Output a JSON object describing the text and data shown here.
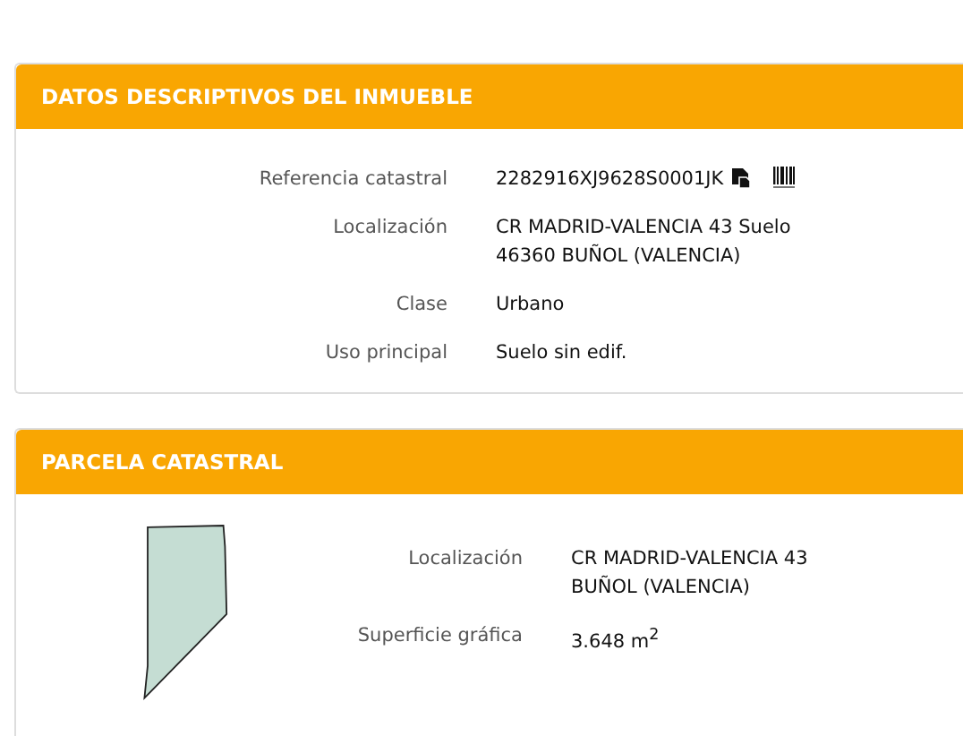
{
  "panels": [
    {
      "title": "DATOS DESCRIPTIVOS DEL INMUEBLE",
      "kind": "details",
      "rows": [
        {
          "label": "Referencia catastral",
          "lines": [
            "2282916XJ9628S0001JK"
          ],
          "icons": true
        },
        {
          "label": "Localización",
          "lines": [
            "CR MADRID-VALENCIA 43 Suelo",
            "46360 BUÑOL (VALENCIA)"
          ]
        },
        {
          "label": "Clase",
          "lines": [
            "Urbano"
          ]
        },
        {
          "label": "Uso principal",
          "lines": [
            "Suelo sin edif."
          ]
        }
      ]
    },
    {
      "title": "PARCELA CATASTRAL",
      "kind": "parcel",
      "rows": [
        {
          "label": "Localización",
          "lines": [
            "CR MADRID-VALENCIA 43",
            "BUÑOL (VALENCIA)"
          ]
        },
        {
          "label": "Superficie gráfica",
          "lines": [
            "3.648 m$^{2}$"
          ]
        }
      ]
    }
  ]
}
